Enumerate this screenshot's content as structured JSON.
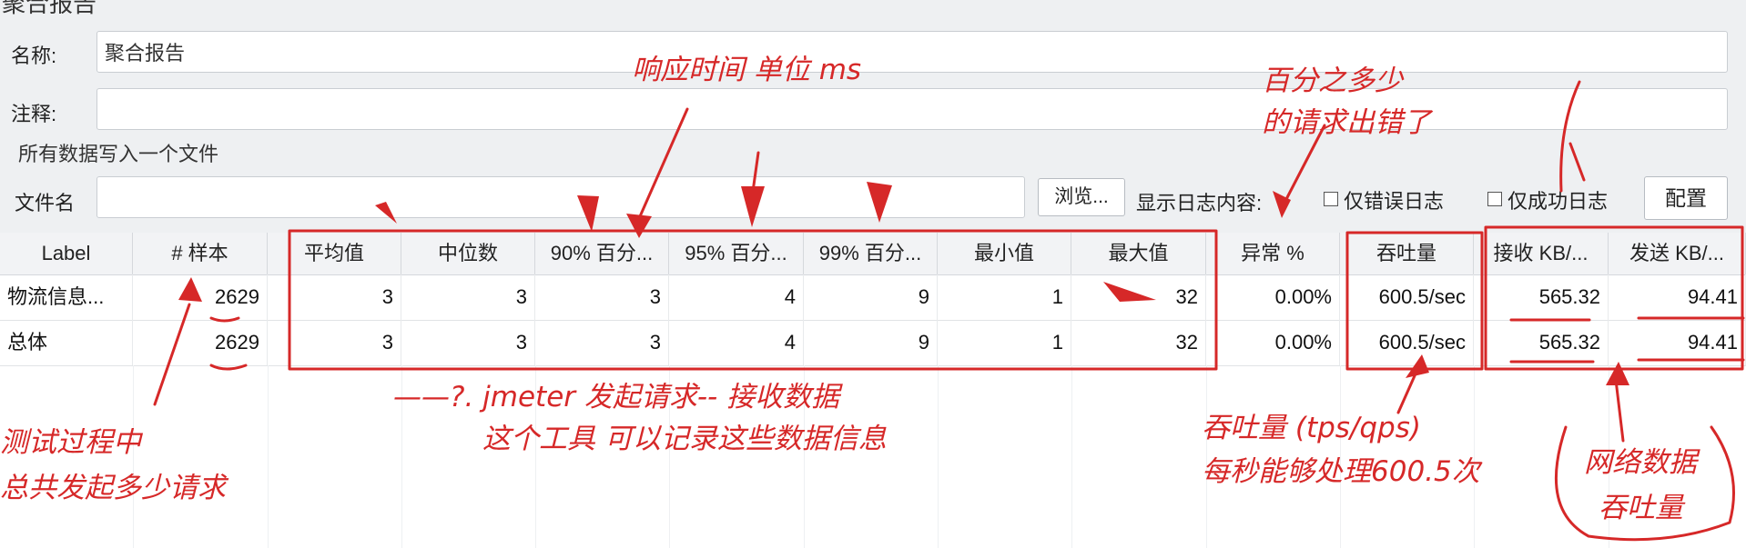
{
  "window": {
    "title": "聚合报告"
  },
  "form": {
    "name_label": "名称:",
    "name_value": "聚合报告",
    "comment_label": "注释:",
    "comment_value": "",
    "section_title": "所有数据写入一个文件",
    "file_label": "文件名",
    "file_value": "",
    "browse_label": "浏览...",
    "log_label": "显示日志内容:",
    "errors_only_label": "仅错误日志",
    "success_only_label": "仅成功日志",
    "config_label": "配置"
  },
  "table": {
    "headers": [
      "Label",
      "# 样本",
      "平均值",
      "中位数",
      "90% 百分...",
      "95% 百分...",
      "99% 百分...",
      "最小值",
      "最大值",
      "异常 %",
      "吞吐量",
      "接收 KB/...",
      "发送 KB/..."
    ],
    "rows": [
      [
        "物流信息...",
        "2629",
        "3",
        "3",
        "3",
        "4",
        "9",
        "1",
        "32",
        "0.00%",
        "600.5/sec",
        "565.32",
        "94.41"
      ],
      [
        "总体",
        "2629",
        "3",
        "3",
        "3",
        "4",
        "9",
        "1",
        "32",
        "0.00%",
        "600.5/sec",
        "565.32",
        "94.41"
      ]
    ]
  },
  "annotations": {
    "response_time": "响应时间 单位 ms",
    "error_pct_1": "百分之多少",
    "error_pct_2": "的请求出错了",
    "jmeter_1": "——?.  jmeter 发起请求-- 接收数据",
    "jmeter_2": "这个工具 可以记录这些数据信息",
    "samples_1": "测试过程中",
    "samples_2": "总共发起多少请求",
    "throughput_1": "吞吐量 (tps/qps)",
    "throughput_2": "每秒能够处理600.5次",
    "network_1": "网络数据",
    "network_2": "吞吐量",
    "color": "#d62828"
  }
}
